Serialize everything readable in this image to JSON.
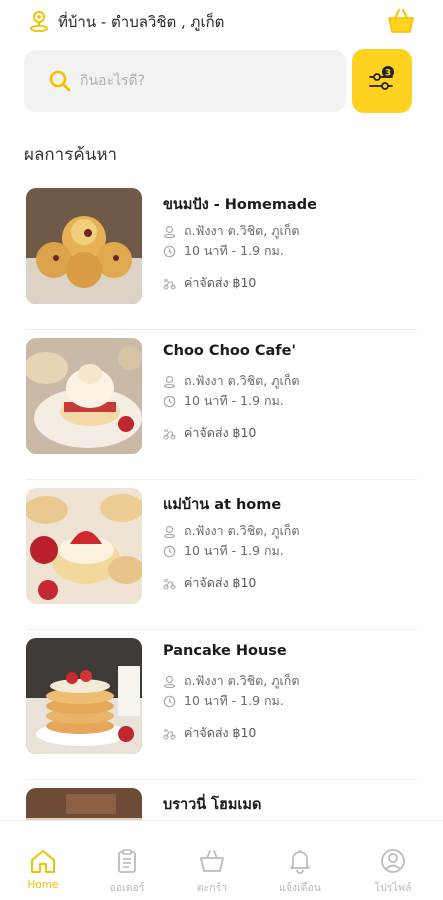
{
  "header": {
    "location_label": "ที่บ้าน - ตำบลวิชิต , ภูเก็ต",
    "location_icon": "location-pin-icon",
    "cart_icon": "basket-icon"
  },
  "search": {
    "placeholder": "กินอะไรดี?",
    "value": "",
    "filter_badge": "3",
    "accent": "#FFD21F"
  },
  "results": {
    "title": "ผลการค้นหา",
    "items": [
      {
        "name": "ขนมปัง - Homemade",
        "address": "ถ.ฟังงา ต.วิชิต, ภูเก็ต",
        "time": "10 นาที - 1.9 กม.",
        "fee": "ค่าจัดส่ง ฿10"
      },
      {
        "name": "Choo Choo Cafe'",
        "address": "ถ.ฟังงา ต.วิชิต, ภูเก็ต",
        "time": "10 นาที - 1.9 กม.",
        "fee": "ค่าจัดส่ง ฿10"
      },
      {
        "name": "แม่บ้าน at home",
        "address": "ถ.ฟังงา ต.วิชิต, ภูเก็ต",
        "time": "10 นาที - 1.9 กม.",
        "fee": "ค่าจัดส่ง ฿10"
      },
      {
        "name": "Pancake House",
        "address": "ถ.ฟังงา ต.วิชิต, ภูเก็ต",
        "time": "10 นาที - 1.9 กม.",
        "fee": "ค่าจัดส่ง ฿10"
      },
      {
        "name": "บราวนี่ โฮมเมด",
        "address": "",
        "time": "",
        "fee": ""
      }
    ]
  },
  "tabbar": {
    "active": "home",
    "tabs": [
      {
        "id": "home",
        "label": "Home",
        "icon": "home-icon"
      },
      {
        "id": "orders",
        "label": "ออเดอร์",
        "icon": "clipboard-icon"
      },
      {
        "id": "basket",
        "label": "ตะกร้า",
        "icon": "basket-icon"
      },
      {
        "id": "notifications",
        "label": "แจ้งเตือน",
        "icon": "bell-icon"
      },
      {
        "id": "profile",
        "label": "โปรไฟล์",
        "icon": "profile-icon"
      }
    ]
  }
}
